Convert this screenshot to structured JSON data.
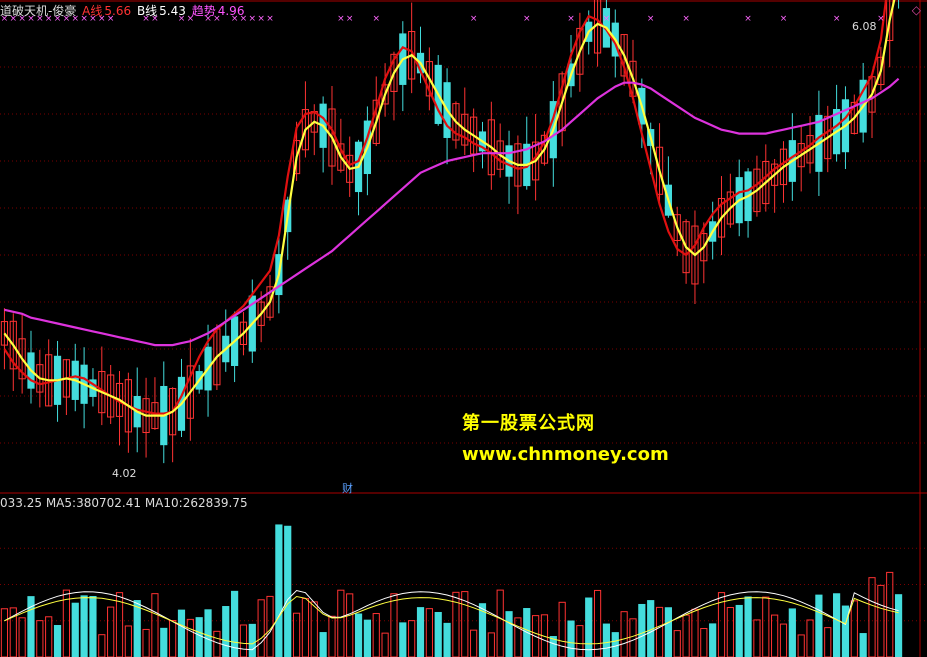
{
  "header": {
    "indicator_name": "道破天机-俊豪",
    "a_line": {
      "label": "A线",
      "value": "5.66",
      "color": "#ff3333"
    },
    "b_line": {
      "label": "B线",
      "value": "5.43",
      "color": "#ffffff"
    },
    "trend": {
      "label": "趋势",
      "value": "4.96",
      "color": "#ff55ff"
    }
  },
  "volume_header": {
    "vol_text": "033.25",
    "ma5_label": "MA5:",
    "ma5_value": "380702.41",
    "ma10_label": "MA10:",
    "ma10_value": "262839.75"
  },
  "annotations": {
    "high": "6.08",
    "low": "4.02",
    "finance_marker": "财"
  },
  "watermark": {
    "line1": "第一股票公式网",
    "line2": "www.chnmoney.com"
  },
  "colors": {
    "up": "#ff3333",
    "down": "#44dddd",
    "a_line": "#e01010",
    "b_line": "#ffff40",
    "trend": "#dd33dd",
    "grid": "#7a0000",
    "marker": "#ff66ff"
  },
  "chart_data": {
    "type": "line",
    "series": [
      {
        "name": "A线",
        "values": [
          4.62,
          4.55,
          4.5,
          4.46,
          4.44,
          4.45,
          4.46,
          4.47,
          4.48,
          4.47,
          4.44,
          4.41,
          4.38,
          4.35,
          4.33,
          4.31,
          4.3,
          4.29,
          4.29,
          4.3,
          4.38,
          4.48,
          4.58,
          4.66,
          4.72,
          4.76,
          4.8,
          4.84,
          4.9,
          4.96,
          5.02,
          5.2,
          5.5,
          5.75,
          5.82,
          5.83,
          5.8,
          5.74,
          5.64,
          5.56,
          5.58,
          5.7,
          5.85,
          6.0,
          6.1,
          6.16,
          6.14,
          6.04,
          5.94,
          5.84,
          5.76,
          5.72,
          5.7,
          5.67,
          5.65,
          5.62,
          5.58,
          5.56,
          5.54,
          5.55,
          5.6,
          5.68,
          5.8,
          5.96,
          6.12,
          6.24,
          6.32,
          6.3,
          6.25,
          6.18,
          6.06,
          5.9,
          5.72,
          5.54,
          5.36,
          5.22,
          5.13,
          5.1,
          5.15,
          5.24,
          5.31,
          5.36,
          5.39,
          5.42,
          5.43,
          5.46,
          5.5,
          5.54,
          5.57,
          5.6,
          5.63,
          5.66,
          5.7,
          5.73,
          5.76,
          5.8,
          5.86,
          5.94,
          6.02,
          6.2,
          6.55,
          6.9
        ]
      },
      {
        "name": "B线",
        "values": [
          4.7,
          4.64,
          4.57,
          4.51,
          4.47,
          4.46,
          4.46,
          4.47,
          4.46,
          4.44,
          4.42,
          4.4,
          4.38,
          4.36,
          4.33,
          4.3,
          4.28,
          4.28,
          4.28,
          4.3,
          4.34,
          4.4,
          4.46,
          4.52,
          4.58,
          4.62,
          4.66,
          4.7,
          4.75,
          4.8,
          4.86,
          5.0,
          5.3,
          5.6,
          5.74,
          5.78,
          5.76,
          5.7,
          5.6,
          5.54,
          5.55,
          5.65,
          5.78,
          5.92,
          6.03,
          6.1,
          6.12,
          6.08,
          6.0,
          5.92,
          5.84,
          5.78,
          5.74,
          5.71,
          5.68,
          5.65,
          5.61,
          5.58,
          5.56,
          5.56,
          5.58,
          5.64,
          5.74,
          5.88,
          6.02,
          6.14,
          6.24,
          6.28,
          6.26,
          6.2,
          6.12,
          6.0,
          5.86,
          5.7,
          5.53,
          5.38,
          5.24,
          5.14,
          5.1,
          5.14,
          5.22,
          5.29,
          5.34,
          5.38,
          5.4,
          5.43,
          5.47,
          5.51,
          5.55,
          5.58,
          5.61,
          5.64,
          5.67,
          5.7,
          5.73,
          5.76,
          5.8,
          5.86,
          5.92,
          6.04,
          6.3,
          6.5
        ]
      },
      {
        "name": "趋势",
        "values": [
          4.82,
          4.81,
          4.8,
          4.78,
          4.77,
          4.76,
          4.75,
          4.74,
          4.73,
          4.72,
          4.71,
          4.7,
          4.69,
          4.68,
          4.67,
          4.66,
          4.65,
          4.64,
          4.64,
          4.64,
          4.65,
          4.66,
          4.68,
          4.7,
          4.73,
          4.76,
          4.79,
          4.82,
          4.85,
          4.88,
          4.91,
          4.94,
          4.97,
          5.0,
          5.03,
          5.06,
          5.09,
          5.12,
          5.16,
          5.2,
          5.24,
          5.28,
          5.32,
          5.36,
          5.4,
          5.44,
          5.48,
          5.52,
          5.54,
          5.56,
          5.58,
          5.59,
          5.6,
          5.61,
          5.62,
          5.62,
          5.62,
          5.62,
          5.63,
          5.64,
          5.66,
          5.68,
          5.71,
          5.74,
          5.78,
          5.82,
          5.86,
          5.9,
          5.93,
          5.96,
          5.98,
          5.98,
          5.97,
          5.95,
          5.92,
          5.89,
          5.86,
          5.83,
          5.8,
          5.78,
          5.76,
          5.74,
          5.73,
          5.72,
          5.72,
          5.72,
          5.72,
          5.73,
          5.74,
          5.75,
          5.76,
          5.77,
          5.78,
          5.8,
          5.82,
          5.84,
          5.86,
          5.88,
          5.9,
          5.93,
          5.96,
          6.0
        ]
      }
    ],
    "ylim": [
      3.9,
      6.3
    ],
    "high_label": "6.08",
    "low_label": "4.02"
  }
}
